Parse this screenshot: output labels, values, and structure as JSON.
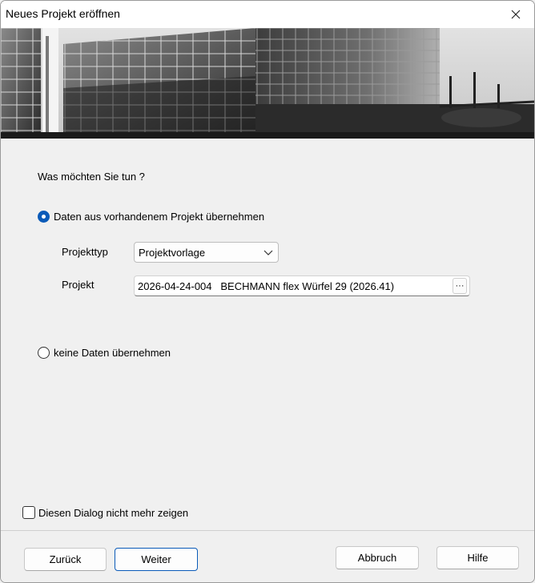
{
  "window": {
    "title": "Neues Projekt eröffnen"
  },
  "question": "Was möchten Sie tun ?",
  "options": {
    "take_data_label": "Daten aus vorhandenem Projekt übernehmen",
    "take_data_selected": true,
    "no_data_label": "keine Daten übernehmen",
    "no_data_selected": false
  },
  "form": {
    "projekttyp_label": "Projekttyp",
    "projekttyp_value": "Projektvorlage",
    "projekt_label": "Projekt",
    "projekt_value": "2026-04-24-004   BECHMANN flex Würfel 29 (2026.41)",
    "browse_label": "···"
  },
  "checkbox": {
    "label": "Diesen Dialog nicht mehr zeigen",
    "checked": false
  },
  "buttons": {
    "back": "Zurück",
    "next": "Weiter",
    "cancel": "Abbruch",
    "help": "Hilfe"
  },
  "colors": {
    "accent": "#0a5ab8",
    "background": "#f0f0f0"
  }
}
